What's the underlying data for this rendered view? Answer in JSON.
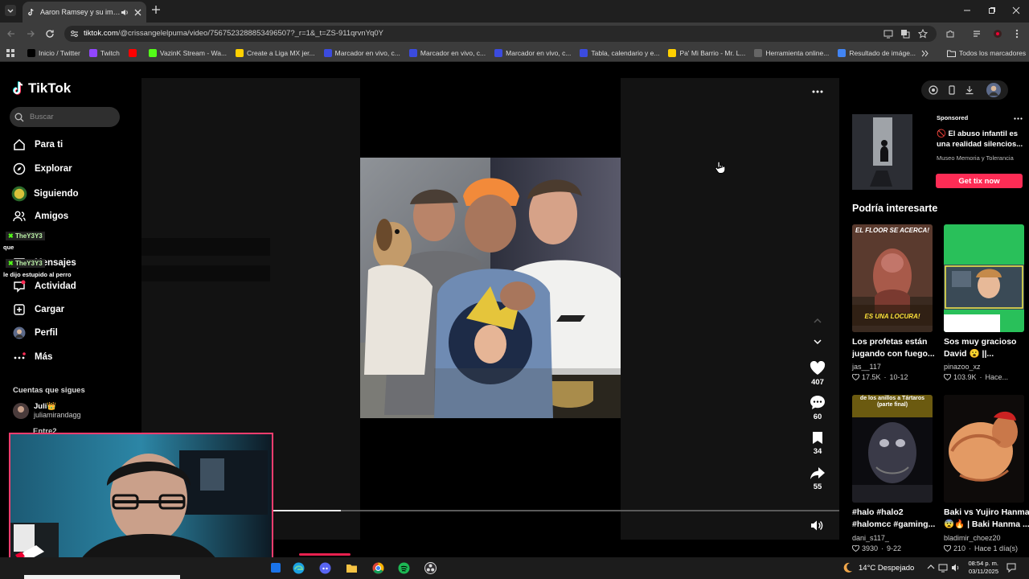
{
  "browser": {
    "tab_title": "Aaron Ramsey y su impacto",
    "url_host": "tiktok.com",
    "url_path": "/@crissangelelpuma/video/7567523288853496507?_r=1&_t=ZS-911qrvnYq0Y",
    "bookmarks": [
      "Inicio / Twitter",
      "Twitch",
      "",
      "VazinK Stream - Wa...",
      "Create a Liga MX jer...",
      "Marcador en vivo, c...",
      "Marcador en vivo, c...",
      "Marcador en vivo, c...",
      "Tabla, calendario y e...",
      "Pa' Mi Barrio - Mr. L...",
      "Herramienta online...",
      "Resultado de imáge..."
    ],
    "bookmark_colors": [
      "#000000",
      "#9146ff",
      "#ff0000",
      "#53fc18",
      "#ffd000",
      "#3b4bdf",
      "#3b4bdf",
      "#3b4bdf",
      "#3b4bdf",
      "#ffd000",
      "#666666",
      "#4285f4"
    ],
    "all_bookmarks": "Todos los marcadores"
  },
  "sidebar": {
    "logo": "TikTok",
    "search_placeholder": "Buscar",
    "nav": [
      "Para ti",
      "Explorar",
      "Siguiendo",
      "Amigos",
      "Mensajes",
      "Actividad",
      "Cargar",
      "Perfil",
      "Más"
    ],
    "chat": [
      {
        "user": "TheY3Y3",
        "text": "que"
      },
      {
        "user": "TheY3Y3",
        "text": "le dijo estupido al perro"
      }
    ],
    "following_header": "Cuentas que sigues",
    "following": [
      {
        "name": "Juli👑",
        "handle": "juliamirandagg"
      },
      {
        "name": "Entre2",
        "handle": ""
      }
    ]
  },
  "video": {
    "progress": 0.12,
    "likes": "407",
    "comments": "60",
    "saves": "34",
    "shares": "55"
  },
  "sponsored": {
    "label": "Sponsored",
    "title": "🚫 El abuso infantil es una realidad silencios...",
    "source": "Museo Memoria y Tolerancia",
    "cta": "Get tix now"
  },
  "recommend": {
    "header": "Podría interesarte",
    "cards": [
      {
        "title1": "Los profetas están",
        "title2": "jugando con fuego...",
        "user": "jas__117",
        "likes": "17.5K",
        "date": "10-12",
        "img_top": "EL FLOOR SE ACERCA!",
        "img_bottom": "ES UNA LOCURA!"
      },
      {
        "title1": "Sos muy gracioso",
        "title2": "David 😮 ||...",
        "user": "pinazoo_xz",
        "likes": "103.9K",
        "date": "Hace..."
      },
      {
        "title1": "#halo #halo2",
        "title2": "#halomcc #gaming...",
        "user": "dani_s117_",
        "likes": "3930",
        "date": "9-22",
        "img_top": "de los anillos a Tártaros (parte final)"
      },
      {
        "title1": "Baki vs Yujiro Hanma",
        "title2": "😨🔥 | Baki Hanma ...",
        "user": "bladimir_choez20",
        "likes": "210",
        "date": "Hace 1 día(s)"
      }
    ]
  },
  "taskbar": {
    "weather": "14°C  Despejado",
    "time": "08:54 p. m.",
    "date": "03/11/2025"
  }
}
